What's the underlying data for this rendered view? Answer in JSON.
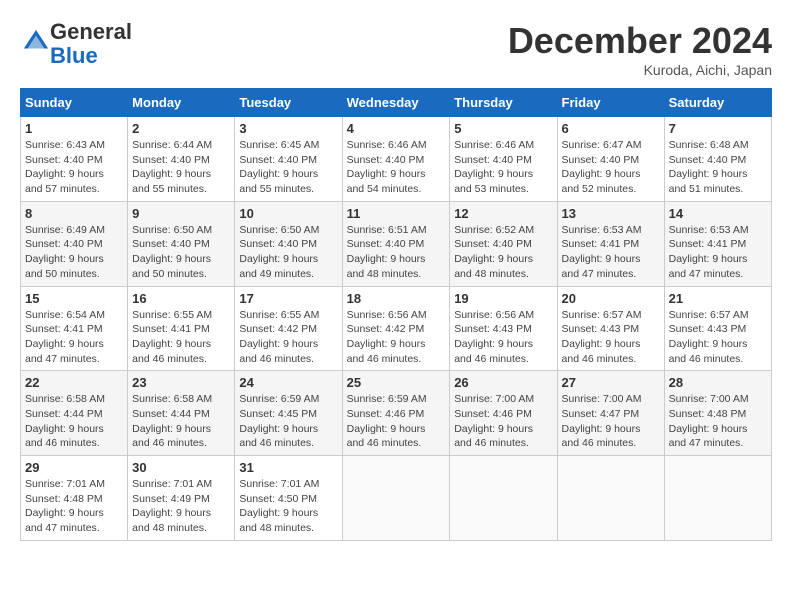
{
  "header": {
    "logo_general": "General",
    "logo_blue": "Blue",
    "month_title": "December 2024",
    "subtitle": "Kuroda, Aichi, Japan"
  },
  "days_of_week": [
    "Sunday",
    "Monday",
    "Tuesday",
    "Wednesday",
    "Thursday",
    "Friday",
    "Saturday"
  ],
  "weeks": [
    [
      {
        "day": 1,
        "info": "Sunrise: 6:43 AM\nSunset: 4:40 PM\nDaylight: 9 hours\nand 57 minutes."
      },
      {
        "day": 2,
        "info": "Sunrise: 6:44 AM\nSunset: 4:40 PM\nDaylight: 9 hours\nand 55 minutes."
      },
      {
        "day": 3,
        "info": "Sunrise: 6:45 AM\nSunset: 4:40 PM\nDaylight: 9 hours\nand 55 minutes."
      },
      {
        "day": 4,
        "info": "Sunrise: 6:46 AM\nSunset: 4:40 PM\nDaylight: 9 hours\nand 54 minutes."
      },
      {
        "day": 5,
        "info": "Sunrise: 6:46 AM\nSunset: 4:40 PM\nDaylight: 9 hours\nand 53 minutes."
      },
      {
        "day": 6,
        "info": "Sunrise: 6:47 AM\nSunset: 4:40 PM\nDaylight: 9 hours\nand 52 minutes."
      },
      {
        "day": 7,
        "info": "Sunrise: 6:48 AM\nSunset: 4:40 PM\nDaylight: 9 hours\nand 51 minutes."
      }
    ],
    [
      {
        "day": 8,
        "info": "Sunrise: 6:49 AM\nSunset: 4:40 PM\nDaylight: 9 hours\nand 50 minutes."
      },
      {
        "day": 9,
        "info": "Sunrise: 6:50 AM\nSunset: 4:40 PM\nDaylight: 9 hours\nand 50 minutes."
      },
      {
        "day": 10,
        "info": "Sunrise: 6:50 AM\nSunset: 4:40 PM\nDaylight: 9 hours\nand 49 minutes."
      },
      {
        "day": 11,
        "info": "Sunrise: 6:51 AM\nSunset: 4:40 PM\nDaylight: 9 hours\nand 48 minutes."
      },
      {
        "day": 12,
        "info": "Sunrise: 6:52 AM\nSunset: 4:40 PM\nDaylight: 9 hours\nand 48 minutes."
      },
      {
        "day": 13,
        "info": "Sunrise: 6:53 AM\nSunset: 4:41 PM\nDaylight: 9 hours\nand 47 minutes."
      },
      {
        "day": 14,
        "info": "Sunrise: 6:53 AM\nSunset: 4:41 PM\nDaylight: 9 hours\nand 47 minutes."
      }
    ],
    [
      {
        "day": 15,
        "info": "Sunrise: 6:54 AM\nSunset: 4:41 PM\nDaylight: 9 hours\nand 47 minutes."
      },
      {
        "day": 16,
        "info": "Sunrise: 6:55 AM\nSunset: 4:41 PM\nDaylight: 9 hours\nand 46 minutes."
      },
      {
        "day": 17,
        "info": "Sunrise: 6:55 AM\nSunset: 4:42 PM\nDaylight: 9 hours\nand 46 minutes."
      },
      {
        "day": 18,
        "info": "Sunrise: 6:56 AM\nSunset: 4:42 PM\nDaylight: 9 hours\nand 46 minutes."
      },
      {
        "day": 19,
        "info": "Sunrise: 6:56 AM\nSunset: 4:43 PM\nDaylight: 9 hours\nand 46 minutes."
      },
      {
        "day": 20,
        "info": "Sunrise: 6:57 AM\nSunset: 4:43 PM\nDaylight: 9 hours\nand 46 minutes."
      },
      {
        "day": 21,
        "info": "Sunrise: 6:57 AM\nSunset: 4:43 PM\nDaylight: 9 hours\nand 46 minutes."
      }
    ],
    [
      {
        "day": 22,
        "info": "Sunrise: 6:58 AM\nSunset: 4:44 PM\nDaylight: 9 hours\nand 46 minutes."
      },
      {
        "day": 23,
        "info": "Sunrise: 6:58 AM\nSunset: 4:44 PM\nDaylight: 9 hours\nand 46 minutes."
      },
      {
        "day": 24,
        "info": "Sunrise: 6:59 AM\nSunset: 4:45 PM\nDaylight: 9 hours\nand 46 minutes."
      },
      {
        "day": 25,
        "info": "Sunrise: 6:59 AM\nSunset: 4:46 PM\nDaylight: 9 hours\nand 46 minutes."
      },
      {
        "day": 26,
        "info": "Sunrise: 7:00 AM\nSunset: 4:46 PM\nDaylight: 9 hours\nand 46 minutes."
      },
      {
        "day": 27,
        "info": "Sunrise: 7:00 AM\nSunset: 4:47 PM\nDaylight: 9 hours\nand 46 minutes."
      },
      {
        "day": 28,
        "info": "Sunrise: 7:00 AM\nSunset: 4:48 PM\nDaylight: 9 hours\nand 47 minutes."
      }
    ],
    [
      {
        "day": 29,
        "info": "Sunrise: 7:01 AM\nSunset: 4:48 PM\nDaylight: 9 hours\nand 47 minutes."
      },
      {
        "day": 30,
        "info": "Sunrise: 7:01 AM\nSunset: 4:49 PM\nDaylight: 9 hours\nand 48 minutes."
      },
      {
        "day": 31,
        "info": "Sunrise: 7:01 AM\nSunset: 4:50 PM\nDaylight: 9 hours\nand 48 minutes."
      },
      null,
      null,
      null,
      null
    ]
  ]
}
